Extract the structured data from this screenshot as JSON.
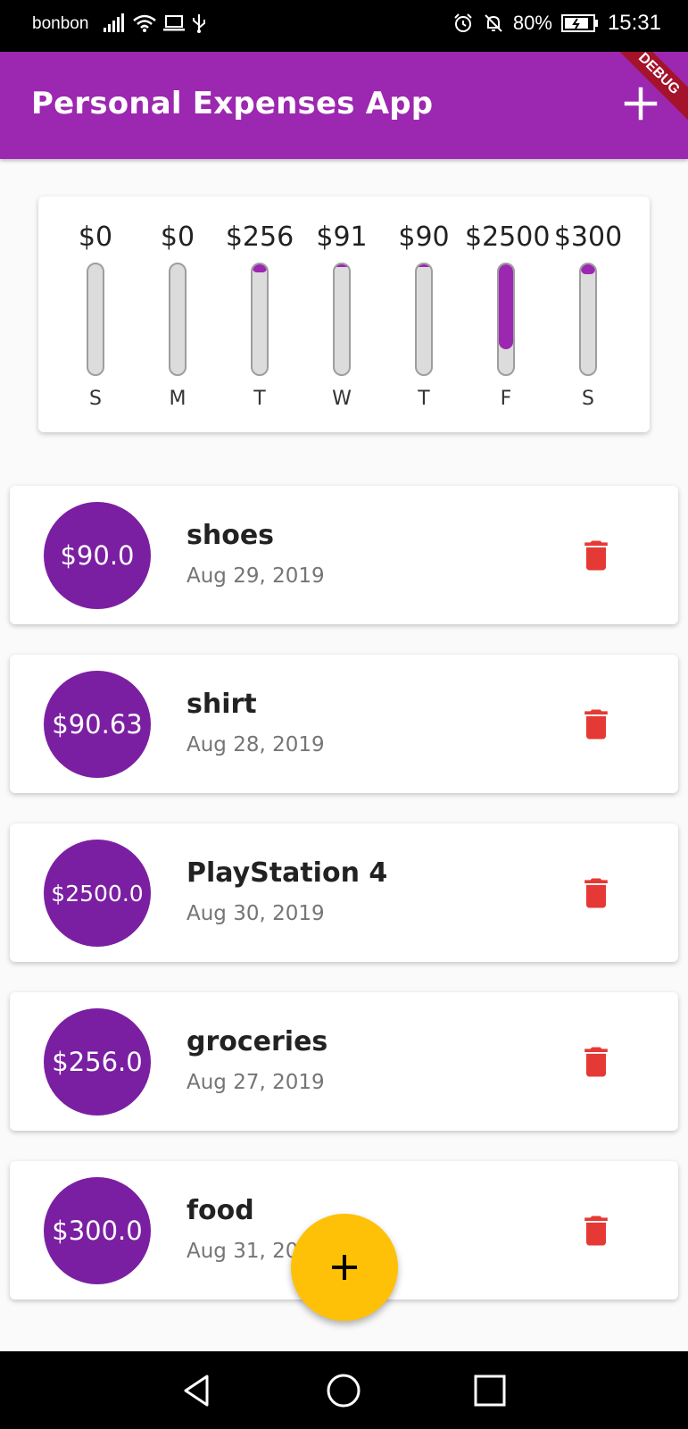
{
  "status_bar": {
    "carrier": "bonbon",
    "battery": "80%",
    "time": "15:31",
    "icons": [
      "signal-icon",
      "wifi-icon",
      "laptop-icon",
      "usb-icon",
      "alarm-icon",
      "bell-off-icon",
      "battery-charging-icon"
    ]
  },
  "app_bar": {
    "title": "Personal Expenses App",
    "add_icon": "plus-icon",
    "debug_banner": "DEBUG",
    "color": "#9c27b0"
  },
  "chart": {
    "bars": [
      {
        "amount": "$0",
        "day": "S",
        "fill": 0.0
      },
      {
        "amount": "$0",
        "day": "M",
        "fill": 0.0
      },
      {
        "amount": "$256",
        "day": "T",
        "fill": 0.075
      },
      {
        "amount": "$91",
        "day": "W",
        "fill": 0.027
      },
      {
        "amount": "$90",
        "day": "T",
        "fill": 0.026
      },
      {
        "amount": "$2500",
        "day": "F",
        "fill": 0.77
      },
      {
        "amount": "$300",
        "day": "S",
        "fill": 0.09
      }
    ]
  },
  "transactions": [
    {
      "amount": "$90.0",
      "title": "shoes",
      "date": "Aug 29, 2019"
    },
    {
      "amount": "$90.63",
      "title": "shirt",
      "date": "Aug 28, 2019"
    },
    {
      "amount": "$2500.0",
      "title": "PlayStation 4",
      "date": "Aug 30, 2019"
    },
    {
      "amount": "$256.0",
      "title": "groceries",
      "date": "Aug 27, 2019"
    },
    {
      "amount": "$300.0",
      "title": "food",
      "date": "Aug 31, 2019"
    }
  ],
  "fab": {
    "icon": "plus-icon",
    "color": "#ffc107"
  },
  "nav": {
    "icons": [
      "back-icon",
      "home-icon",
      "recents-icon"
    ]
  },
  "colors": {
    "primary": "#9c27b0",
    "avatar": "#7b1fa2",
    "delete": "#e53935",
    "accent": "#ffc107"
  }
}
